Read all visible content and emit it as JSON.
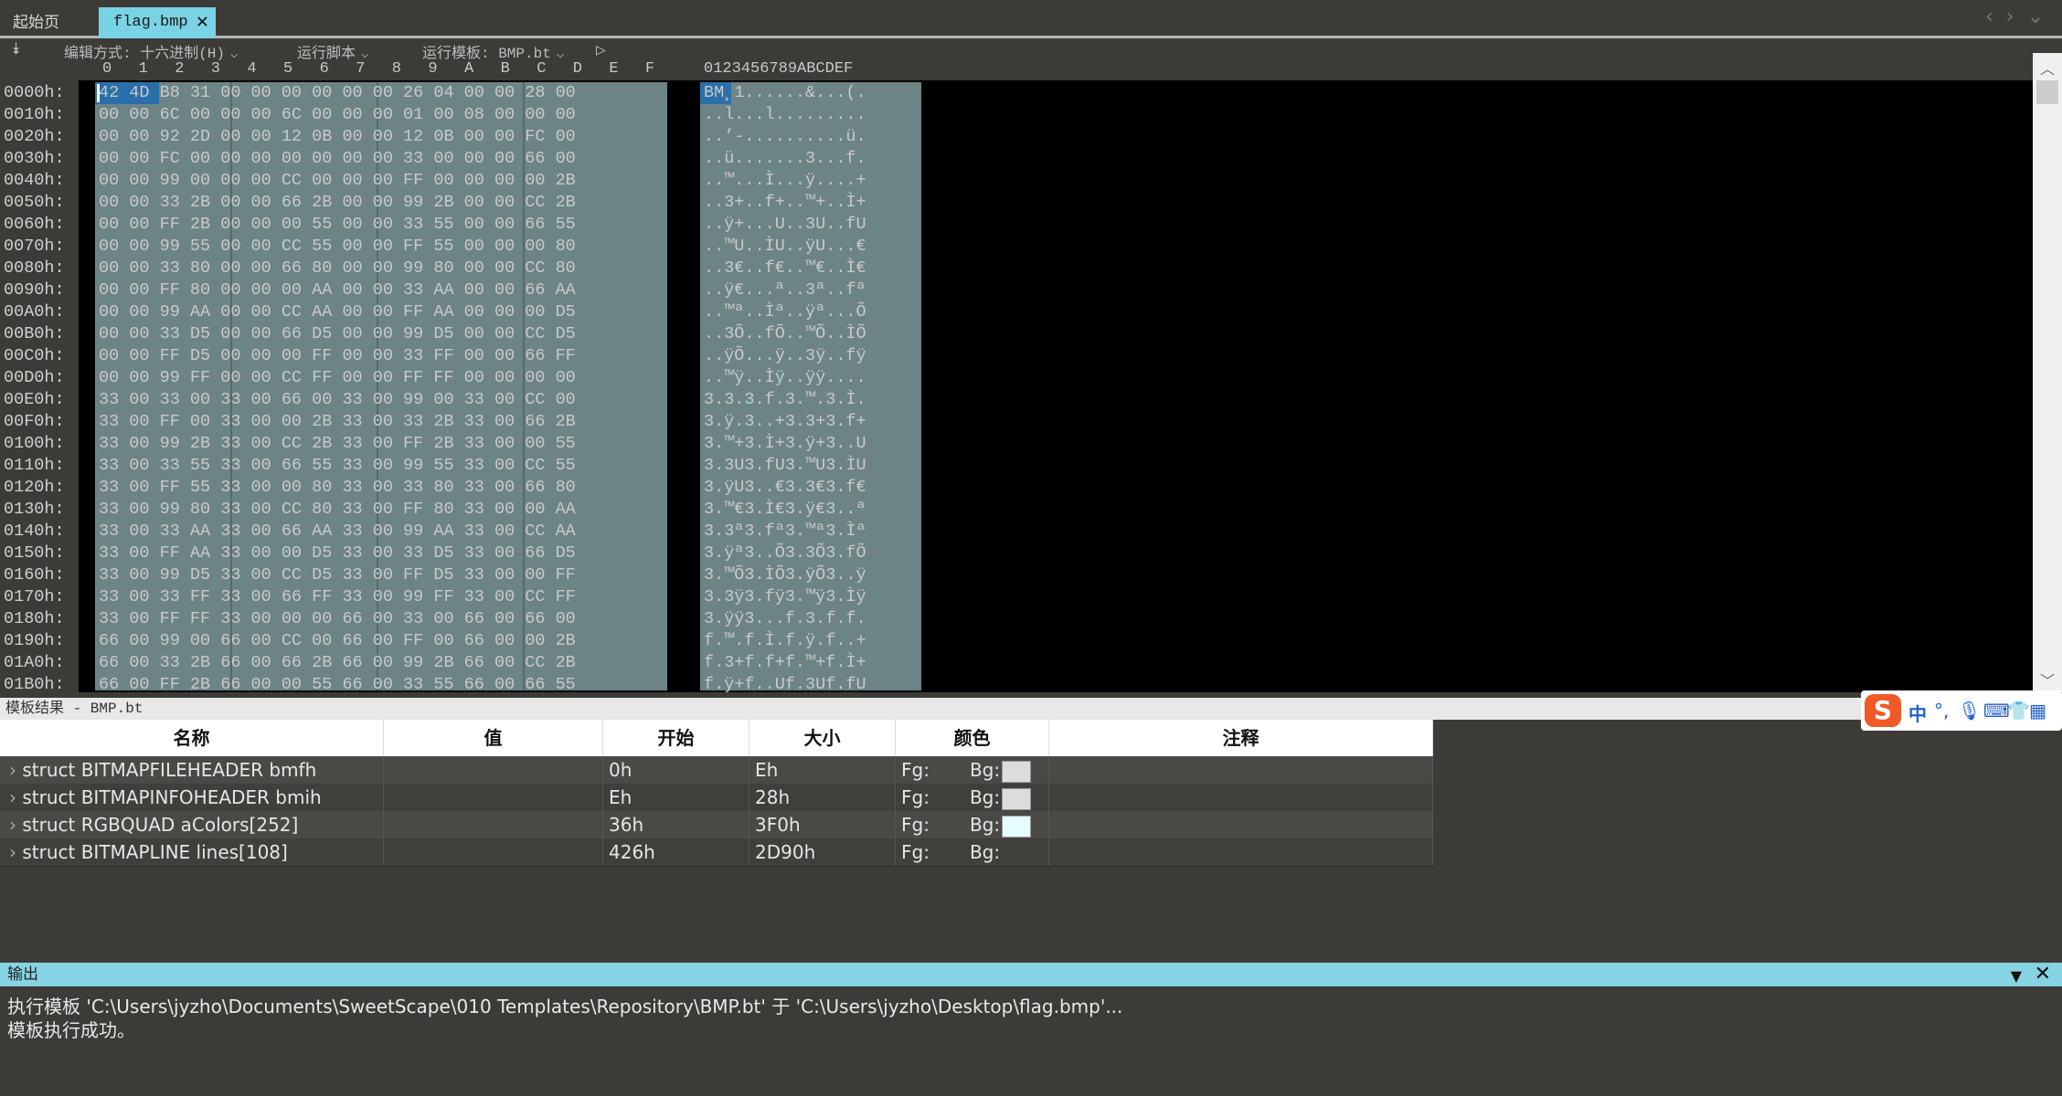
{
  "tabs": {
    "start": "起始页",
    "active": "flag.bmp"
  },
  "toolbar": {
    "edit_mode": "编辑方式: 十六进制(H)",
    "run_script": "运行脚本",
    "run_template": "运行模板: BMP.bt"
  },
  "column_header": {
    "hex_cols": [
      "0",
      "1",
      "2",
      "3",
      "4",
      "5",
      "6",
      "7",
      "8",
      "9",
      "A",
      "B",
      "C",
      "D",
      "E",
      "F"
    ],
    "ascii_cols": "0123456789ABCDEF"
  },
  "hex_rows": [
    {
      "addr": "0000h:",
      "hex": "42 4D B8 31 00 00 00 00 00 00 26 04 00 00 28 00",
      "ascii": "BM¸1......&...(."
    },
    {
      "addr": "0010h:",
      "hex": "00 00 6C 00 00 00 6C 00 00 00 01 00 08 00 00 00",
      "ascii": "..l...l........."
    },
    {
      "addr": "0020h:",
      "hex": "00 00 92 2D 00 00 12 0B 00 00 12 0B 00 00 FC 00",
      "ascii": "..’-..........ü."
    },
    {
      "addr": "0030h:",
      "hex": "00 00 FC 00 00 00 00 00 00 00 33 00 00 00 66 00",
      "ascii": "..ü.......3...f."
    },
    {
      "addr": "0040h:",
      "hex": "00 00 99 00 00 00 CC 00 00 00 FF 00 00 00 00 2B",
      "ascii": "..™...Ì...ÿ....+"
    },
    {
      "addr": "0050h:",
      "hex": "00 00 33 2B 00 00 66 2B 00 00 99 2B 00 00 CC 2B",
      "ascii": "..3+..f+..™+..Ì+"
    },
    {
      "addr": "0060h:",
      "hex": "00 00 FF 2B 00 00 00 55 00 00 33 55 00 00 66 55",
      "ascii": "..ÿ+...U..3U..fU"
    },
    {
      "addr": "0070h:",
      "hex": "00 00 99 55 00 00 CC 55 00 00 FF 55 00 00 00 80",
      "ascii": "..™U..ÌU..ÿU...€"
    },
    {
      "addr": "0080h:",
      "hex": "00 00 33 80 00 00 66 80 00 00 99 80 00 00 CC 80",
      "ascii": "..3€..f€..™€..Ì€"
    },
    {
      "addr": "0090h:",
      "hex": "00 00 FF 80 00 00 00 AA 00 00 33 AA 00 00 66 AA",
      "ascii": "..ÿ€...ª..3ª..fª"
    },
    {
      "addr": "00A0h:",
      "hex": "00 00 99 AA 00 00 CC AA 00 00 FF AA 00 00 00 D5",
      "ascii": "..™ª..Ìª..ÿª...Õ"
    },
    {
      "addr": "00B0h:",
      "hex": "00 00 33 D5 00 00 66 D5 00 00 99 D5 00 00 CC D5",
      "ascii": "..3Õ..fÕ..™Õ..ÌÕ"
    },
    {
      "addr": "00C0h:",
      "hex": "00 00 FF D5 00 00 00 FF 00 00 33 FF 00 00 66 FF",
      "ascii": "..ÿÕ...ÿ..3ÿ..fÿ"
    },
    {
      "addr": "00D0h:",
      "hex": "00 00 99 FF 00 00 CC FF 00 00 FF FF 00 00 00 00",
      "ascii": "..™ÿ..Ìÿ..ÿÿ...."
    },
    {
      "addr": "00E0h:",
      "hex": "33 00 33 00 33 00 66 00 33 00 99 00 33 00 CC 00",
      "ascii": "3.3.3.f.3.™.3.Ì."
    },
    {
      "addr": "00F0h:",
      "hex": "33 00 FF 00 33 00 00 2B 33 00 33 2B 33 00 66 2B",
      "ascii": "3.ÿ.3..+3.3+3.f+"
    },
    {
      "addr": "0100h:",
      "hex": "33 00 99 2B 33 00 CC 2B 33 00 FF 2B 33 00 00 55",
      "ascii": "3.™+3.Ì+3.ÿ+3..U"
    },
    {
      "addr": "0110h:",
      "hex": "33 00 33 55 33 00 66 55 33 00 99 55 33 00 CC 55",
      "ascii": "3.3U3.fU3.™U3.ÌU"
    },
    {
      "addr": "0120h:",
      "hex": "33 00 FF 55 33 00 00 80 33 00 33 80 33 00 66 80",
      "ascii": "3.ÿU3..€3.3€3.f€"
    },
    {
      "addr": "0130h:",
      "hex": "33 00 99 80 33 00 CC 80 33 00 FF 80 33 00 00 AA",
      "ascii": "3.™€3.Ì€3.ÿ€3..ª"
    },
    {
      "addr": "0140h:",
      "hex": "33 00 33 AA 33 00 66 AA 33 00 99 AA 33 00 CC AA",
      "ascii": "3.3ª3.fª3.™ª3.Ìª"
    },
    {
      "addr": "0150h:",
      "hex": "33 00 FF AA 33 00 00 D5 33 00 33 D5 33 00 66 D5",
      "ascii": "3.ÿª3..Õ3.3Õ3.fÕ"
    },
    {
      "addr": "0160h:",
      "hex": "33 00 99 D5 33 00 CC D5 33 00 FF D5 33 00 00 FF",
      "ascii": "3.™Õ3.ÌÕ3.ÿÕ3..ÿ"
    },
    {
      "addr": "0170h:",
      "hex": "33 00 33 FF 33 00 66 FF 33 00 99 FF 33 00 CC FF",
      "ascii": "3.3ÿ3.fÿ3.™ÿ3.Ìÿ"
    },
    {
      "addr": "0180h:",
      "hex": "33 00 FF FF 33 00 00 00 66 00 33 00 66 00 66 00",
      "ascii": "3.ÿÿ3...f.3.f.f."
    },
    {
      "addr": "0190h:",
      "hex": "66 00 99 00 66 00 CC 00 66 00 FF 00 66 00 00 2B",
      "ascii": "f.™.f.Ì.f.ÿ.f..+"
    },
    {
      "addr": "01A0h:",
      "hex": "66 00 33 2B 66 00 66 2B 66 00 99 2B 66 00 CC 2B",
      "ascii": "f.3+f.f+f.™+f.Ì+"
    },
    {
      "addr": "01B0h:",
      "hex": "66 00 FF 2B 66 00 00 55 66 00 33 55 66 00 66 55",
      "ascii": "f.ÿ+f..Uf.3Uf.fU"
    }
  ],
  "template_panel": {
    "title": "模板结果 - BMP.bt",
    "headers": {
      "name": "名称",
      "value": "值",
      "start": "开始",
      "size": "大小",
      "color": "颜色",
      "comment": "注释"
    },
    "rows": [
      {
        "name": "struct BITMAPFILEHEADER bmfh",
        "value": "",
        "start": "0h",
        "size": "Eh",
        "fg": "Fg:",
        "bg": "Bg:",
        "bg_color": "#dcdcdc"
      },
      {
        "name": "struct BITMAPINFOHEADER bmih",
        "value": "",
        "start": "Eh",
        "size": "28h",
        "fg": "Fg:",
        "bg": "Bg:",
        "bg_color": "#dcdcdc"
      },
      {
        "name": "struct RGBQUAD aColors[252]",
        "value": "",
        "start": "36h",
        "size": "3F0h",
        "fg": "Fg:",
        "bg": "Bg:",
        "bg_color": "#e6ffff"
      },
      {
        "name": "struct BITMAPLINE lines[108]",
        "value": "",
        "start": "426h",
        "size": "2D90h",
        "fg": "Fg:",
        "bg": "Bg:",
        "bg_color": ""
      }
    ]
  },
  "output_panel": {
    "title": "输出",
    "lines": [
      "执行模板 'C:\\Users\\jyzho\\Documents\\SweetScape\\010 Templates\\Repository\\BMP.bt' 于 'C:\\Users\\jyzho\\Desktop\\flag.bmp'...",
      "模板执行成功。"
    ]
  },
  "ime": {
    "logo": "S",
    "lang": "中"
  },
  "colors": {
    "accent": "#79d3e4",
    "selection": "#2a6fa8",
    "data_bg": "#6d8486"
  }
}
